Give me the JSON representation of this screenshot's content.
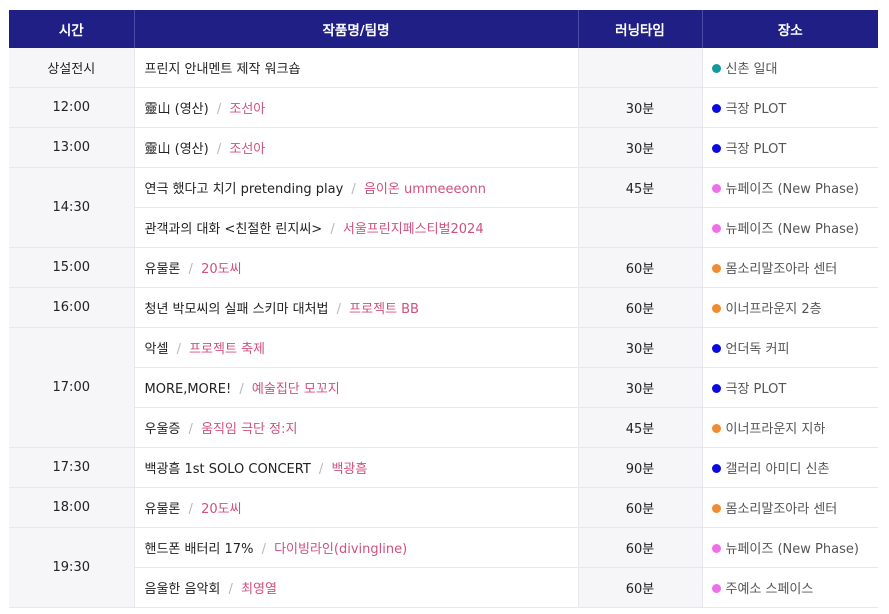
{
  "headers": {
    "time": "시간",
    "work": "작품명/팀명",
    "runtime": "러닝타임",
    "venue": "장소"
  },
  "separator": "/",
  "colors": {
    "header_bg": "#1f1f86",
    "team_text": "#d0507e",
    "row_alt": "#f6f6f8"
  },
  "rows": [
    {
      "time": "상설전시",
      "work": "프린지 안내멘트 제작 워크숍",
      "team": "",
      "runtime": "",
      "venue": "신촌 일대",
      "dot": "#12999a"
    },
    {
      "time": "12:00",
      "work": "靈山 (영산)",
      "team": "조선아",
      "runtime": "30분",
      "venue": "극장 PLOT",
      "dot": "#0a0adf"
    },
    {
      "time": "13:00",
      "work": "靈山 (영산)",
      "team": "조선아",
      "runtime": "30분",
      "venue": "극장 PLOT",
      "dot": "#0a0adf"
    },
    {
      "time": "14:30",
      "work": "연극 했다고 치기 pretending play",
      "team": "음이온 ummeeeonn",
      "runtime": "45분",
      "venue": "뉴페이즈 (New Phase)",
      "dot": "#f06ee8"
    },
    {
      "time": "",
      "work": "관객과의 대화 <친절한 린지씨>",
      "team": "서울프린지페스티벌2024",
      "runtime": "",
      "venue": "뉴페이즈 (New Phase)",
      "dot": "#f06ee8"
    },
    {
      "time": "15:00",
      "work": "유물론",
      "team": "20도씨",
      "runtime": "60분",
      "venue": "몸소리말조아라 센터",
      "dot": "#f28a2e"
    },
    {
      "time": "16:00",
      "work": "청년 박모씨의 실패 스키마 대처법",
      "team": "프로젝트 BB",
      "runtime": "60분",
      "venue": "이너프라운지 2층",
      "dot": "#f28a2e"
    },
    {
      "time": "17:00",
      "work": "악셀",
      "team": "프로젝트 축제",
      "runtime": "30분",
      "venue": "언더독 커피",
      "dot": "#0a0adf"
    },
    {
      "time": "",
      "work": "MORE,MORE!",
      "team": "예술집단 모꼬지",
      "runtime": "30분",
      "venue": "극장 PLOT",
      "dot": "#0a0adf"
    },
    {
      "time": "",
      "work": "우울증",
      "team": "움직임 극단 정:지",
      "runtime": "45분",
      "venue": "이너프라운지 지하",
      "dot": "#f28a2e"
    },
    {
      "time": "17:30",
      "work": "백광흠 1st SOLO CONCERT",
      "team": "백광흠",
      "runtime": "90분",
      "venue": "갤러리 아미디 신촌",
      "dot": "#0a0adf"
    },
    {
      "time": "18:00",
      "work": "유물론",
      "team": "20도씨",
      "runtime": "60분",
      "venue": "몸소리말조아라 센터",
      "dot": "#f28a2e"
    },
    {
      "time": "19:30",
      "work": "핸드폰 배터리 17%",
      "team": "다이빙라인(divingline)",
      "runtime": "60분",
      "venue": "뉴페이즈 (New Phase)",
      "dot": "#f06ee8"
    },
    {
      "time": "",
      "work": "음울한 음악회",
      "team": "최영열",
      "runtime": "60분",
      "venue": "주예소 스페이스",
      "dot": "#f06ee8"
    }
  ]
}
